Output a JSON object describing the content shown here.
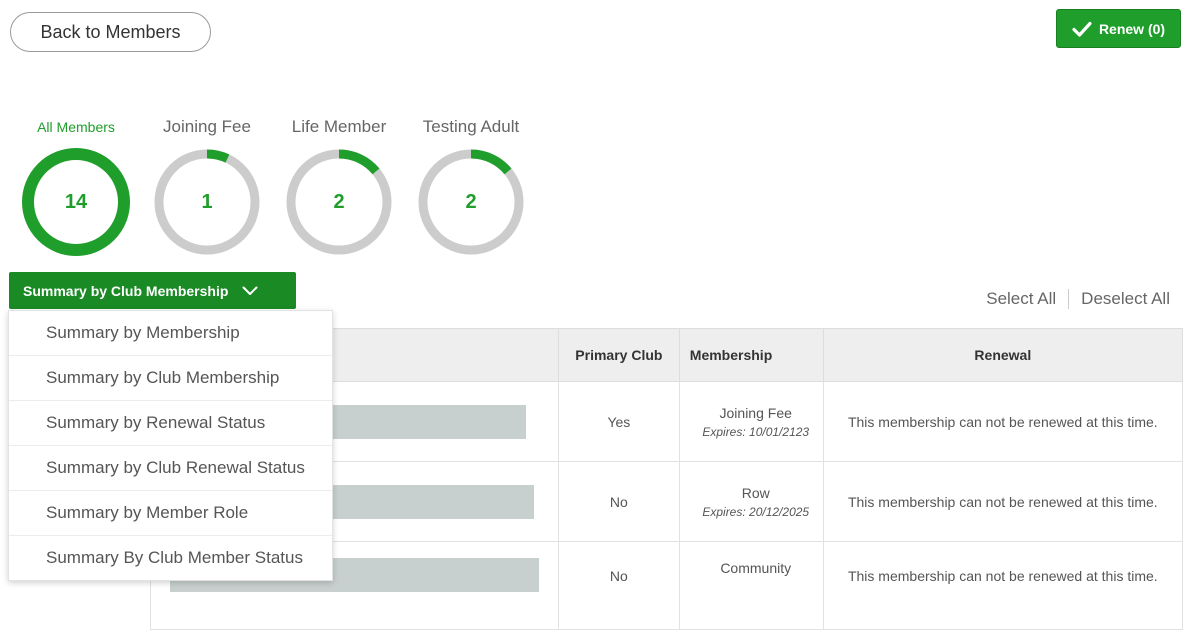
{
  "header": {
    "back_label": "Back to Members",
    "renew_label": "Renew (0)"
  },
  "stats": [
    {
      "label": "All Members",
      "count": "14",
      "fraction": 1.0,
      "active": true
    },
    {
      "label": "Joining Fee",
      "count": "1",
      "fraction": 0.07
    },
    {
      "label": "Life Member",
      "count": "2",
      "fraction": 0.14
    },
    {
      "label": "Testing Adult",
      "count": "2",
      "fraction": 0.14
    }
  ],
  "summary": {
    "button_label": "Summary by Club Membership",
    "options": [
      "Summary by Membership",
      "Summary by Club Membership",
      "Summary by Renewal Status",
      "Summary by Club Renewal Status",
      "Summary by Member Role",
      "Summary By Club Member Status"
    ]
  },
  "selection": {
    "select_all": "Select All",
    "deselect_all": "Deselect All"
  },
  "table": {
    "headers": [
      "ail",
      "Primary Club",
      "Membership",
      "Renewal"
    ],
    "rows": [
      {
        "primary": "Yes",
        "membership": "Joining Fee",
        "expires": "Expires: 10/01/2123",
        "renewal": "This membership can not be renewed at this time."
      },
      {
        "primary": "No",
        "membership": "Row",
        "expires": "Expires: 20/12/2025",
        "renewal": "This membership can not be renewed at this time."
      },
      {
        "primary": "No",
        "membership": "Community",
        "expires": "",
        "renewal": "This membership can not be renewed at this time."
      }
    ]
  },
  "colors": {
    "accent": "#1f9e2b",
    "ring_track": "#cccccc"
  }
}
